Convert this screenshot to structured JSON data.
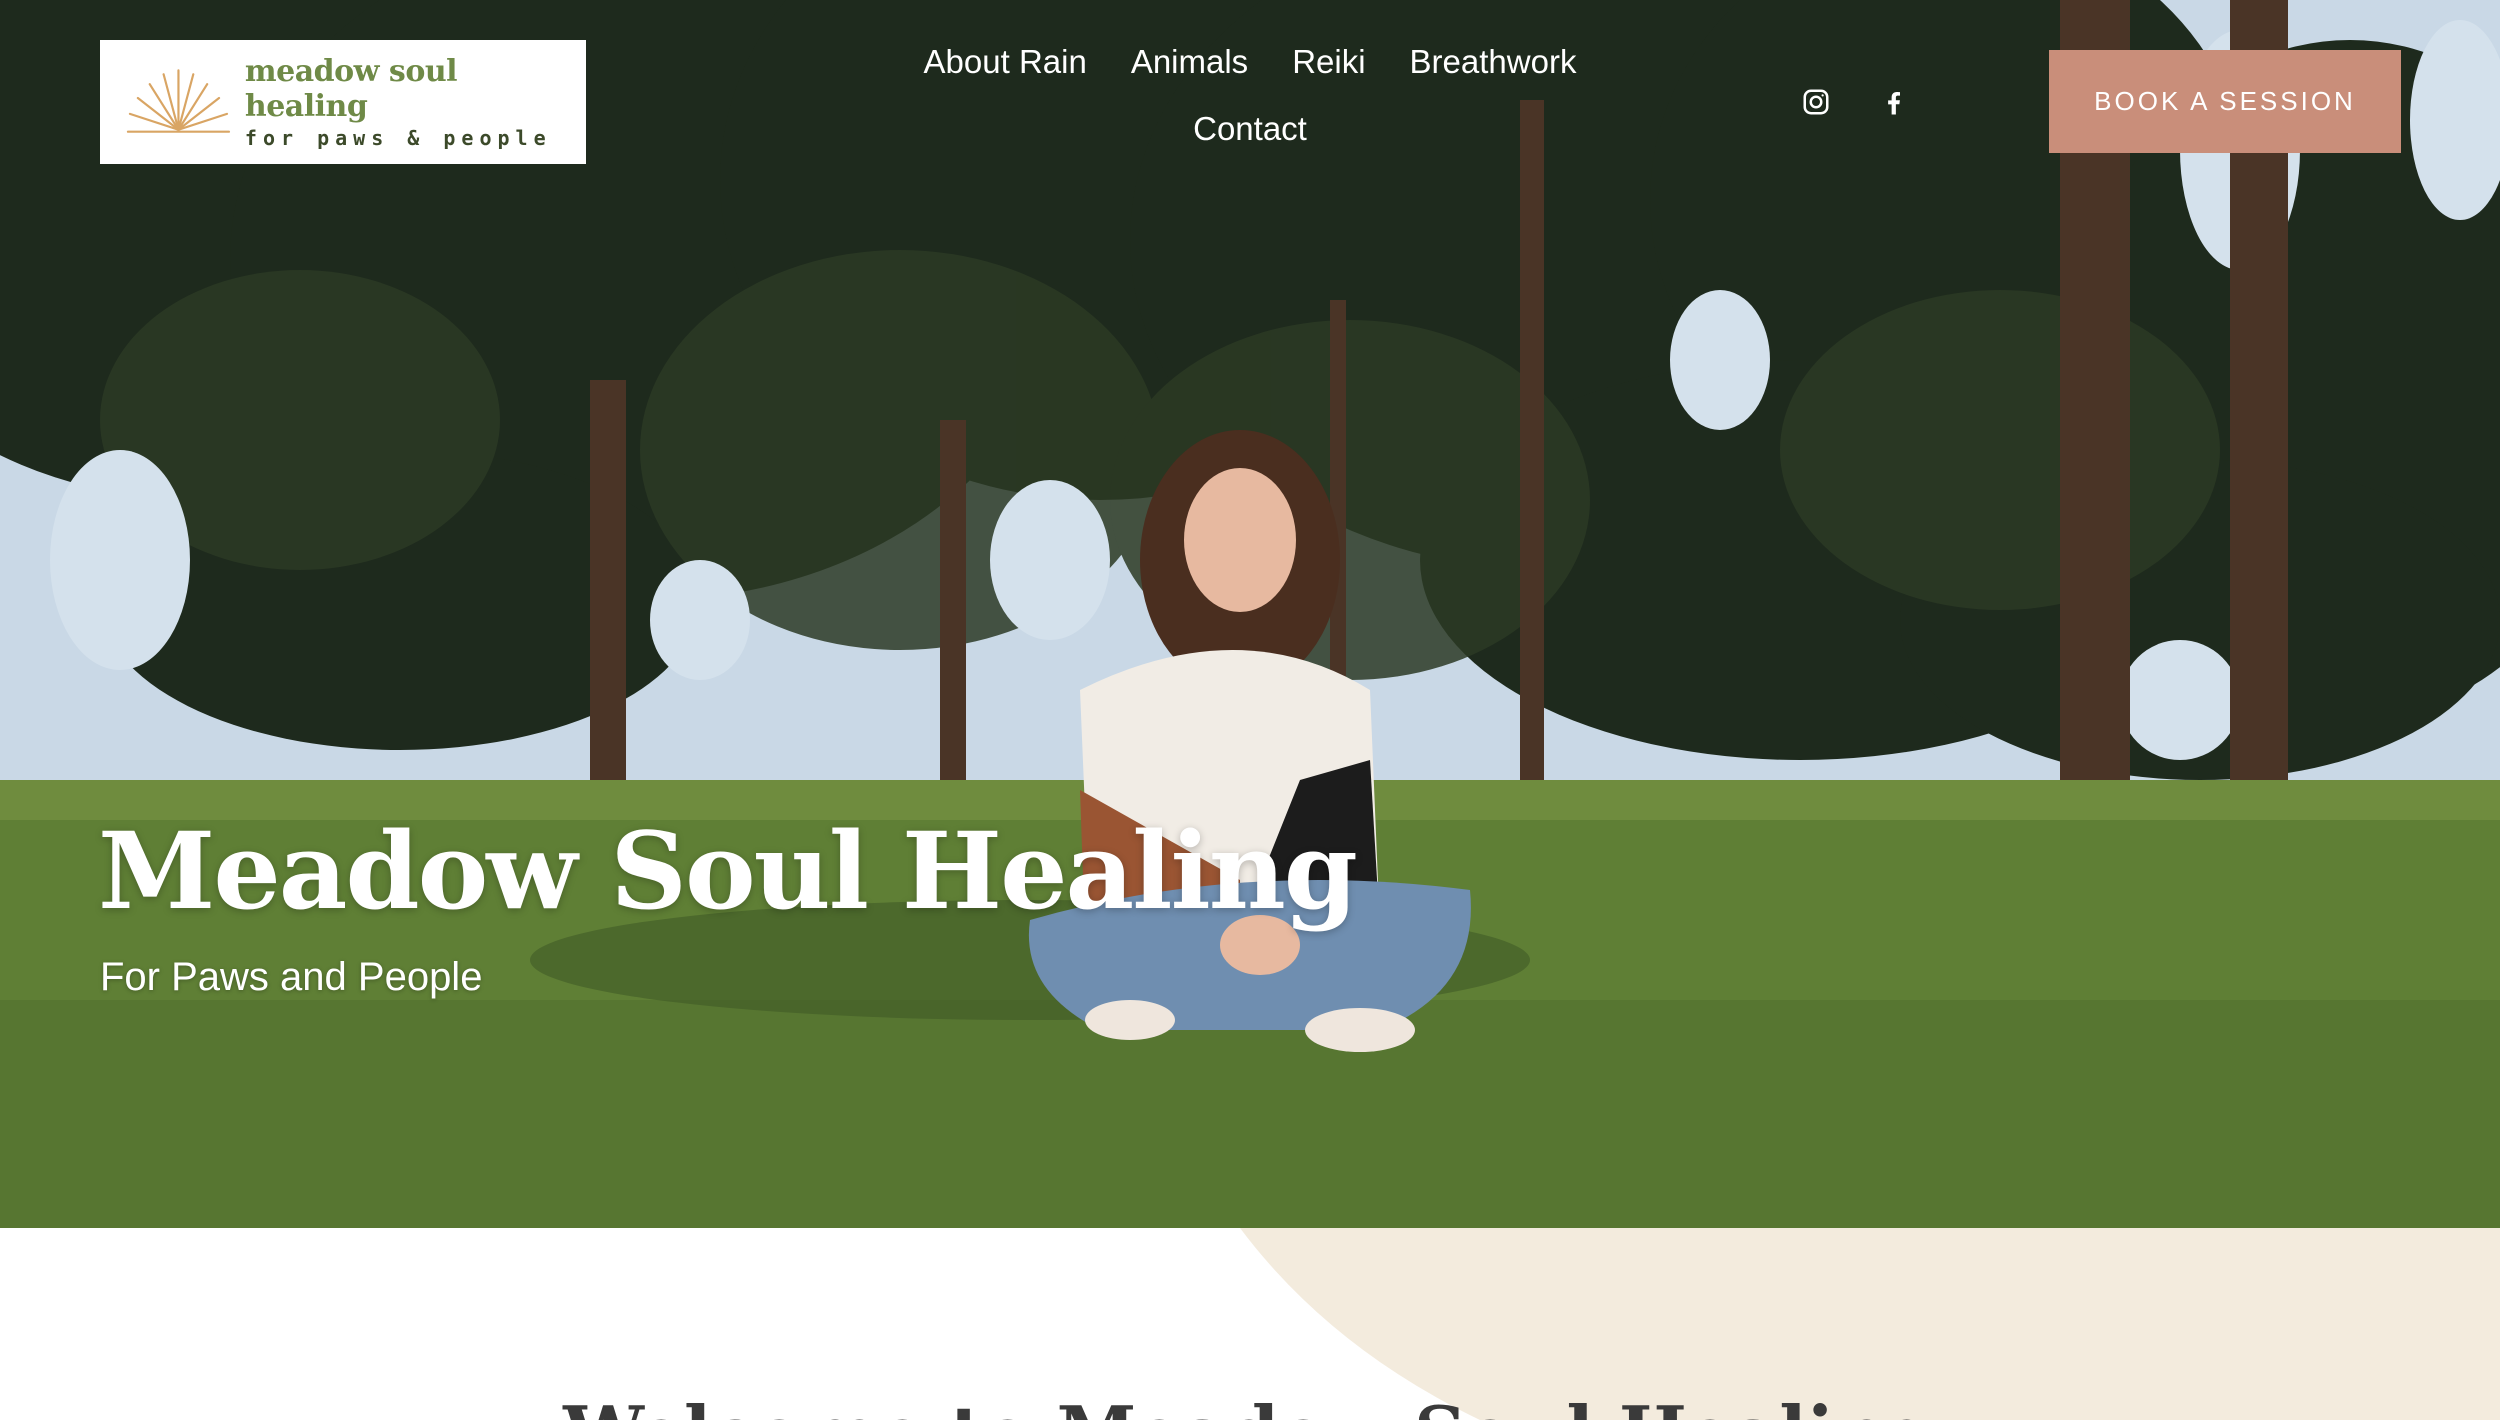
{
  "logo": {
    "title": "meadow soul healing",
    "subtitle": "for paws & people"
  },
  "nav": {
    "items": [
      {
        "label": "About Rain"
      },
      {
        "label": "Animals"
      },
      {
        "label": "Reiki"
      },
      {
        "label": "Breathwork"
      },
      {
        "label": "Contact"
      }
    ]
  },
  "social": {
    "icons": [
      "instagram-icon",
      "facebook-icon"
    ]
  },
  "cta": {
    "label": "BOOK A SESSION",
    "color": "#c98e7a"
  },
  "hero": {
    "title": "Meadow Soul Healing",
    "subtitle": "For Paws and People"
  },
  "section": {
    "heading": "Welcome to Meadow Soul Healing",
    "accent_color": "#f3ebdd"
  }
}
